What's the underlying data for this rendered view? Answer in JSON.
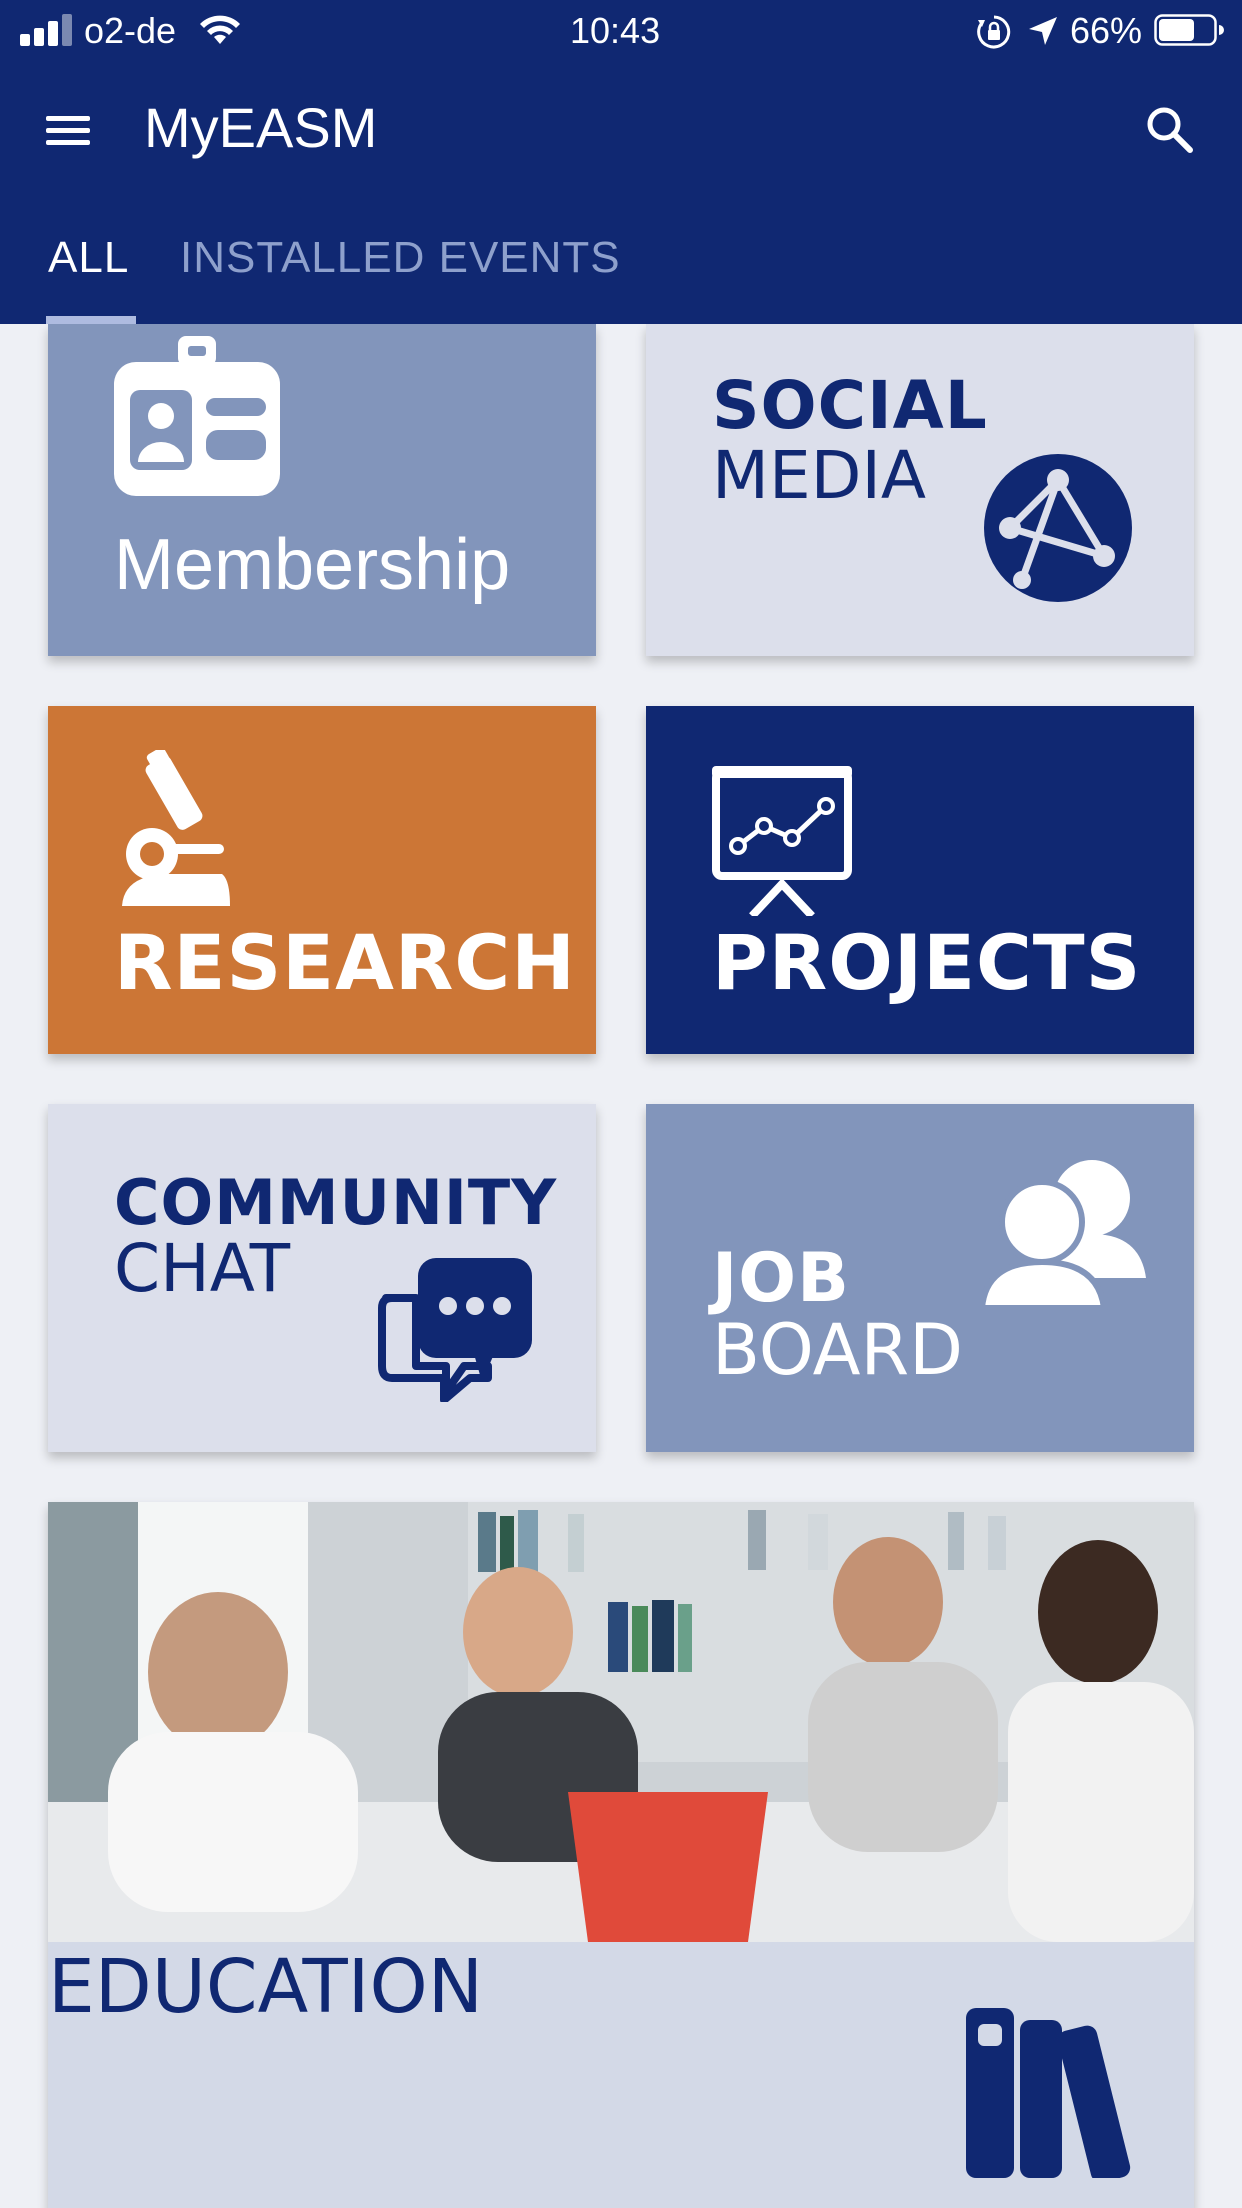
{
  "status_bar": {
    "carrier": "o2-de",
    "time": "10:43",
    "battery": "66%",
    "battery_level": 0.66
  },
  "app_bar": {
    "title": "MyEASM",
    "menu_icon": "hamburger-menu-icon",
    "search_icon": "search-icon"
  },
  "tabs": [
    {
      "label": "ALL",
      "active": true
    },
    {
      "label": "INSTALLED EVENTS",
      "active": false
    }
  ],
  "tiles": {
    "membership": {
      "label": "Membership",
      "icon": "id-badge-icon"
    },
    "social_media": {
      "line1": "SOCIAL",
      "line2": "MEDIA",
      "icon": "globe-network-icon"
    },
    "research": {
      "label": "RESEARCH",
      "icon": "microscope-icon"
    },
    "projects": {
      "label": "PROJECTS",
      "icon": "presentation-chart-icon"
    },
    "community_chat": {
      "line1": "COMMUNITY",
      "line2": "CHAT",
      "icon": "chat-bubble-icon"
    },
    "job_board": {
      "line1": "JOB",
      "line2": "BOARD",
      "icon": "people-icon"
    },
    "education": {
      "label": "EDUCATION",
      "icon": "books-icon"
    }
  },
  "colors": {
    "navy": "#102872",
    "slate": "#8295bb",
    "light": "#dcdfeb",
    "orange": "#cc7636",
    "tab_inactive": "#8ea0cc"
  }
}
